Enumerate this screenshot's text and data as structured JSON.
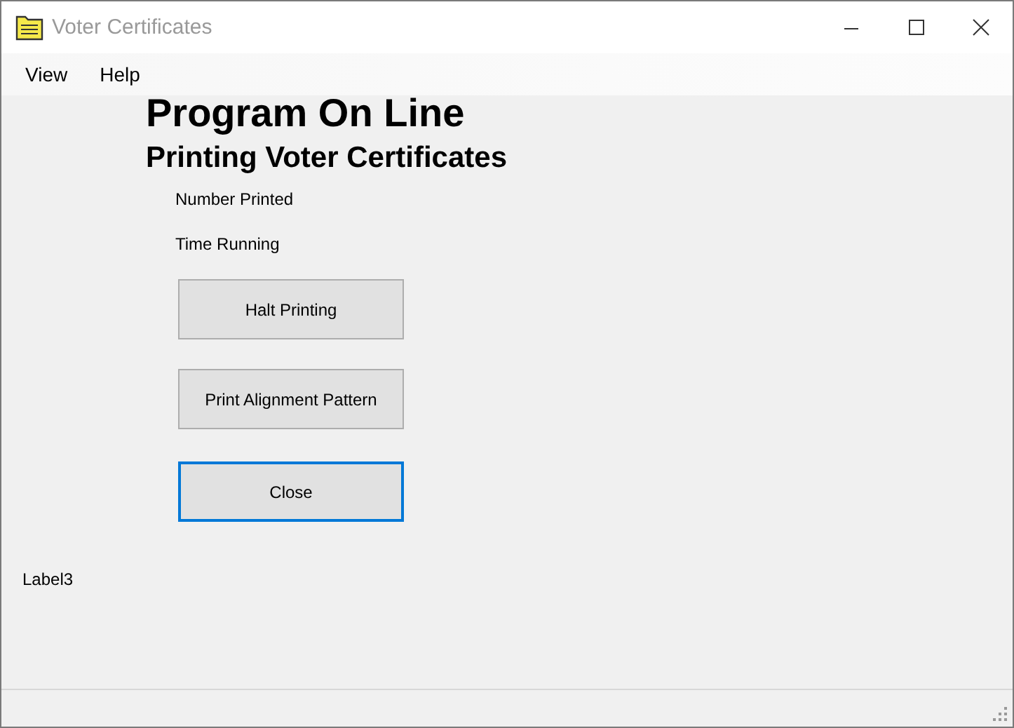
{
  "window": {
    "title": "Voter Certificates"
  },
  "menu": [
    "View",
    "Help"
  ],
  "heading": "Program On Line",
  "subheading": "Printing Voter Certificates",
  "labels": [
    "Number Printed",
    "Time Running"
  ],
  "buttons": [
    {
      "label": "Halt Printing",
      "focused": false
    },
    {
      "label": "Print Alignment Pattern",
      "focused": false
    },
    {
      "label": "Close",
      "focused": true
    }
  ],
  "footer_label": "Label3"
}
